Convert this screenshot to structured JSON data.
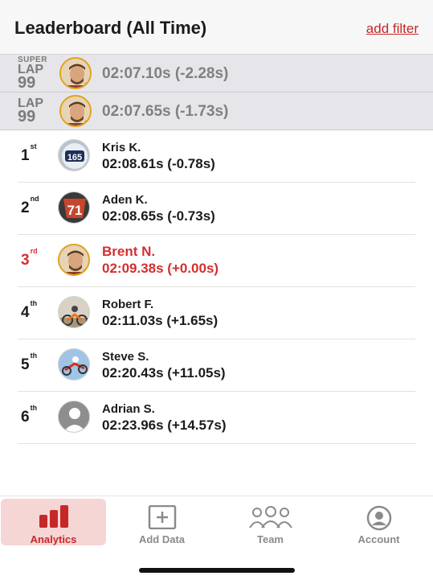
{
  "header": {
    "title": "Leaderboard (All Time)",
    "add_filter": "add filter"
  },
  "lap_records": [
    {
      "badge_super": "SUPER",
      "badge_lap": "LAP",
      "badge_num": "99",
      "time": "02:07.10s (-2.28s)"
    },
    {
      "badge_super": "",
      "badge_lap": "LAP",
      "badge_num": "99",
      "time": "02:07.65s (-1.73s)"
    }
  ],
  "entries": [
    {
      "rank": "1",
      "suffix": "st",
      "name": "Kris K.",
      "time": "02:08.61s (-0.78s)",
      "avatar": "rider-165-photo",
      "highlight": false
    },
    {
      "rank": "2",
      "suffix": "nd",
      "name": "Aden K.",
      "time": "02:08.65s (-0.73s)",
      "avatar": "rider-71-photo",
      "highlight": false
    },
    {
      "rank": "3",
      "suffix": "rd",
      "name": "Brent N.",
      "time": "02:09.38s (+0.00s)",
      "avatar": "brent-photo",
      "highlight": true
    },
    {
      "rank": "4",
      "suffix": "th",
      "name": "Robert F.",
      "time": "02:11.03s (+1.65s)",
      "avatar": "dirt-bike-photo",
      "highlight": false
    },
    {
      "rank": "5",
      "suffix": "th",
      "name": "Steve S.",
      "time": "02:20.43s (+11.05s)",
      "avatar": "jump-photo",
      "highlight": false
    },
    {
      "rank": "6",
      "suffix": "th",
      "name": "Adrian S.",
      "time": "02:23.96s (+14.57s)",
      "avatar": "default-user-icon",
      "highlight": false
    }
  ],
  "tabs": [
    {
      "label": "Analytics",
      "icon": "bar-chart-icon",
      "active": true
    },
    {
      "label": "Add Data",
      "icon": "plus-square-icon",
      "active": false
    },
    {
      "label": "Team",
      "icon": "people-icon",
      "active": false
    },
    {
      "label": "Account",
      "icon": "user-circle-icon",
      "active": false
    }
  ],
  "colors": {
    "accent": "#c62828",
    "highlight_text": "#d32f2f",
    "active_tab_bg": "#f6d5d5",
    "lap_row_bg": "#e6e6ea",
    "gold_border": "#e0a21a"
  }
}
